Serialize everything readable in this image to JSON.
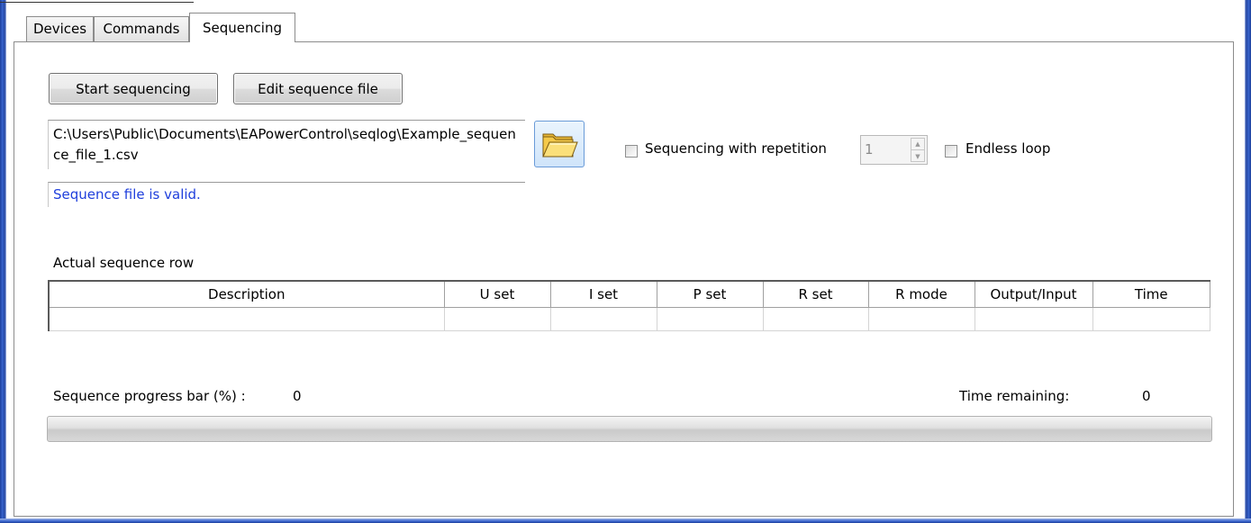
{
  "tabs": [
    {
      "label": "Devices"
    },
    {
      "label": "Commands"
    },
    {
      "label": "Sequencing",
      "active": true
    }
  ],
  "actions": {
    "start_label": "Start sequencing",
    "edit_label": "Edit sequence file"
  },
  "file": {
    "path": "C:\\Users\\Public\\Documents\\EAPowerControl\\seqlog\\Example_sequence_file_1.csv",
    "status": "Sequence file is valid.",
    "browse_icon": "folder-open-icon"
  },
  "repetition": {
    "label": "Sequencing with repetition",
    "checked": false,
    "count": "1",
    "endless_label": "Endless loop",
    "endless_checked": false
  },
  "sequence_table": {
    "title": "Actual sequence row",
    "columns": [
      "Description",
      "U set",
      "I set",
      "P set",
      "R set",
      "R mode",
      "Output/Input",
      "Time"
    ],
    "rows": [
      [
        "",
        "",
        "",
        "",
        "",
        "",
        "",
        ""
      ]
    ]
  },
  "progress": {
    "label": "Sequence progress bar (%) :",
    "value": "0",
    "percent": 0,
    "time_label": "Time remaining:",
    "time_value": "0"
  },
  "colors": {
    "status_text": "#1f3fdc",
    "window_frame": "#1c3f9c",
    "progress_fill": "#37c51f"
  }
}
